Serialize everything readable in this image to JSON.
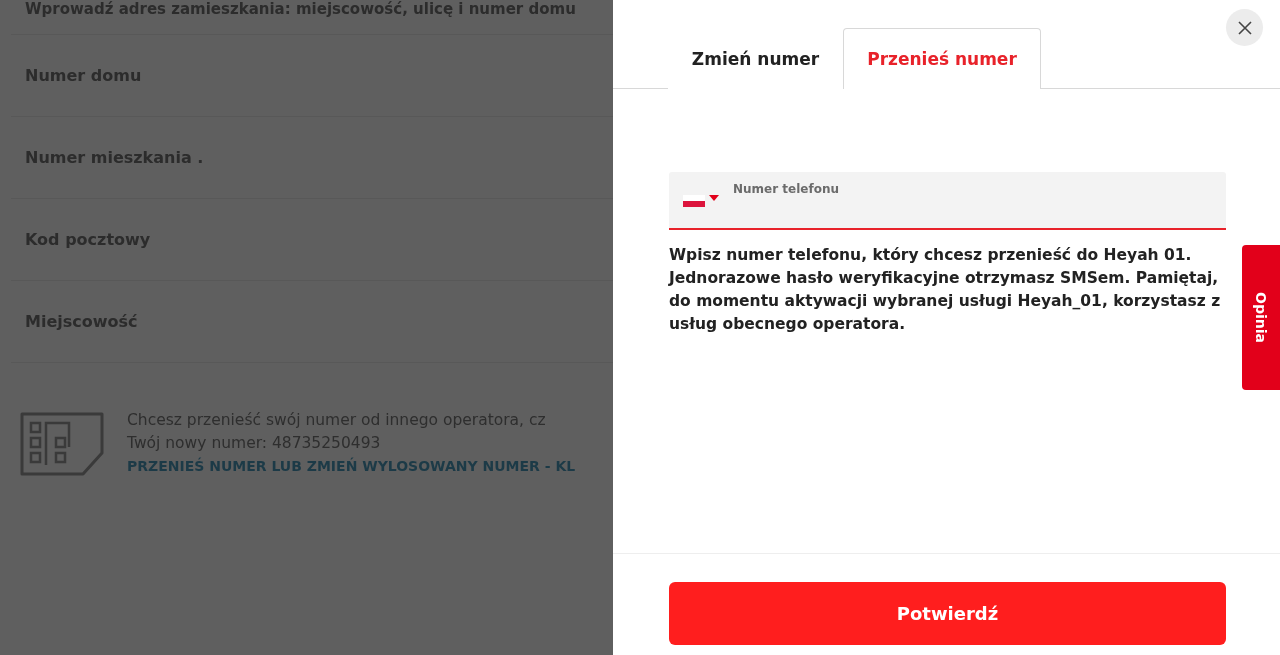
{
  "background_form": {
    "address_hint": "Wprowadź adres zamieszkania: miejscowość, ulicę i numer domu",
    "fields": [
      {
        "label": "Numer domu"
      },
      {
        "label": "Numer mieszkania ."
      },
      {
        "label": "Kod pocztowy"
      },
      {
        "label": "Miejscowość"
      }
    ],
    "sim_info": {
      "question": "Chcesz przenieść swój numer od innego operatora, cz",
      "new_number": "Twój nowy numer: 48735250493",
      "link": "PRZENIEŚ NUMER LUB ZMIEŃ WYLOSOWANY NUMER - KL"
    }
  },
  "panel": {
    "tabs": [
      {
        "label": "Zmień numer",
        "selected": false
      },
      {
        "label": "Przenieś numer",
        "selected": true
      }
    ],
    "phone_field": {
      "label": "Numer telefonu"
    },
    "description": "Wpisz numer telefonu, który chcesz przenieść do Heyah 01. Jednorazowe hasło weryfikacyjne otrzymasz SMSem. Pamiętaj, do momentu aktywacji wybranej usługi Heyah_01, korzystasz z usług obecnego operatora.",
    "confirm_button": "Potwierdź"
  },
  "feedback_tab": "Opinia"
}
